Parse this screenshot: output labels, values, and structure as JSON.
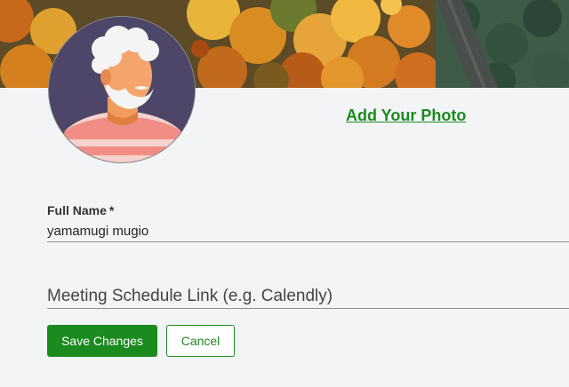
{
  "profile": {
    "cover_image": "autumn-forest-aerial",
    "avatar_image": "white-haired-bearded-man-striped-shirt",
    "add_photo_label": "Add Your Photo"
  },
  "form": {
    "full_name": {
      "label": "Full Name",
      "required_marker": "*",
      "value": "yamamugi mugio"
    },
    "meeting_link": {
      "placeholder": "Meeting Schedule Link (e.g. Calendly)",
      "value": ""
    }
  },
  "actions": {
    "save_label": "Save Changes",
    "cancel_label": "Cancel"
  },
  "colors": {
    "accent": "#1b8a1f",
    "background": "#f3f4f6",
    "avatar_bg": "#4d4668"
  }
}
